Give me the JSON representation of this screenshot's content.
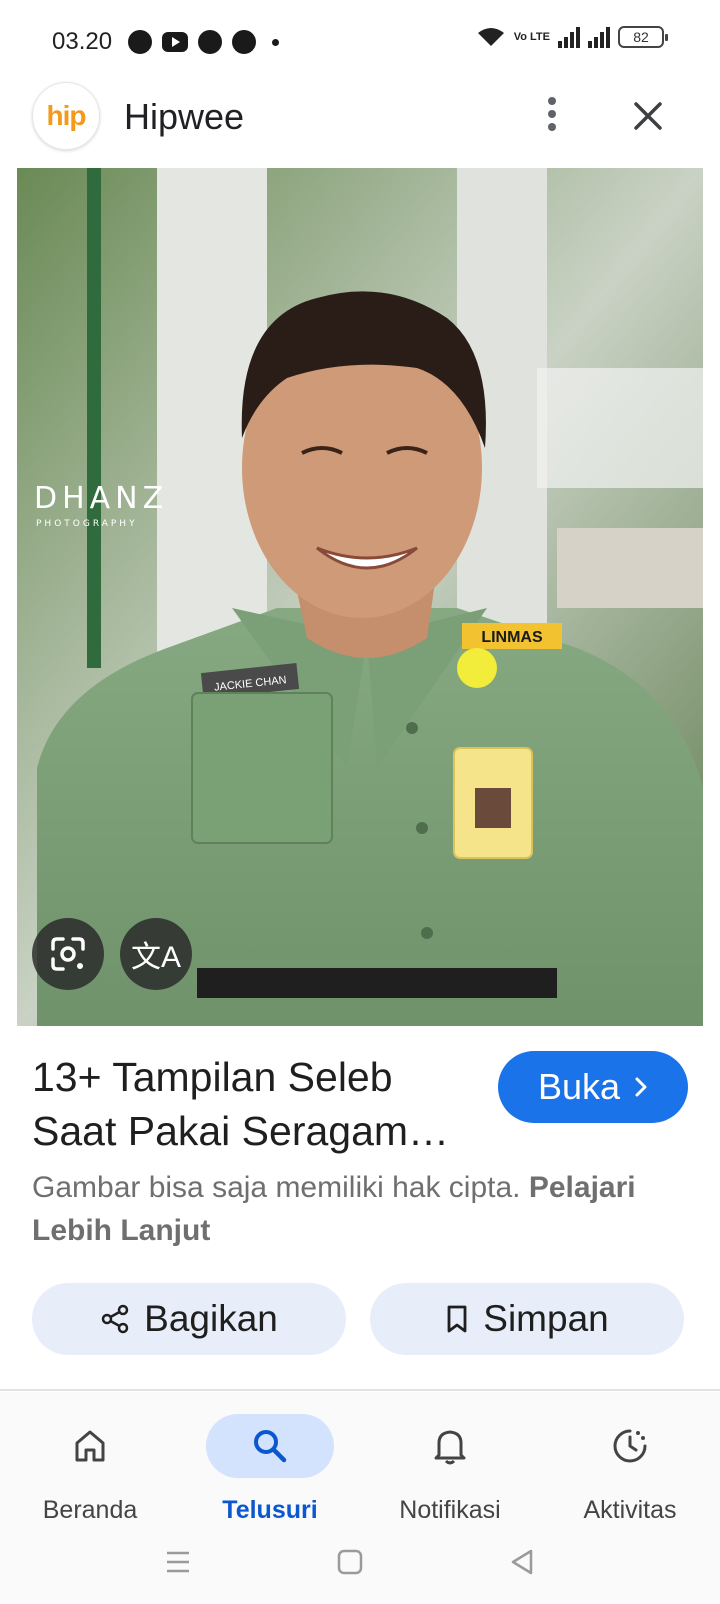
{
  "status_bar": {
    "time": "03.20",
    "volte": "Vo LTE",
    "battery": "82"
  },
  "header": {
    "site_logo": "hip",
    "site_name": "Hipwee"
  },
  "image": {
    "watermark": "DHANZ",
    "watermark_sub": "PHOTOGRAPHY",
    "name_tag": "JACKIE CHAN",
    "badge": "LINMAS",
    "translate_icon": "文A"
  },
  "result": {
    "title": "13+ Tampilan Seleb Saat Pakai Seragam…",
    "open_label": "Buka",
    "copyright_text": "Gambar bisa saja memiliki hak cipta.",
    "learn_more": "Pelajari Lebih Lanjut"
  },
  "actions": {
    "share_label": "Bagikan",
    "save_label": "Simpan"
  },
  "bottom_nav": {
    "items": [
      {
        "label": "Beranda",
        "icon": "home-icon"
      },
      {
        "label": "Telusuri",
        "icon": "search-icon",
        "active": true
      },
      {
        "label": "Notifikasi",
        "icon": "bell-icon"
      },
      {
        "label": "Aktivitas",
        "icon": "activity-icon"
      }
    ]
  },
  "colors": {
    "accent": "#1a73e8",
    "active_nav_bg": "#d3e3fd",
    "active_nav_text": "#0b57d0",
    "action_bg": "#e8eef9",
    "logo_orange": "#f39a1c",
    "uniform_green": "#7fa47a"
  }
}
